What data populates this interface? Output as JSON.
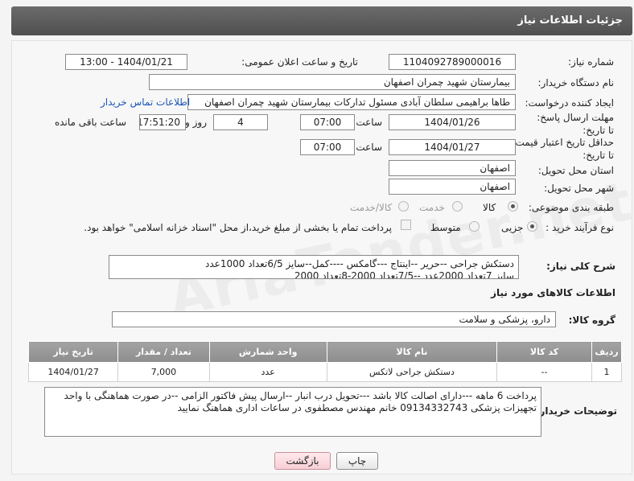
{
  "header": {
    "title": "جزئیات اطلاعات نیاز"
  },
  "fields": {
    "need_number_label": "شماره نیاز:",
    "need_number": "1104092789000016",
    "announce_label": "تاریخ و ساعت اعلان عمومی:",
    "announce_value": "1404/01/21 - 13:00",
    "buyer_org_label": "نام دستگاه خریدار:",
    "buyer_org": "بیمارستان شهید چمران اصفهان",
    "requester_label": "ایجاد کننده درخواست:",
    "requester": "طاها براهیمی سلطان آبادی مسئول تدارکات  بیمارستان شهید چمران اصفهان",
    "buyer_contact_link": "اطلاعات تماس خریدار",
    "reply_deadline_label": "مهلت ارسال پاسخ: تا تاریخ:",
    "reply_date": "1404/01/26",
    "time_label": "ساعت",
    "reply_time": "07:00",
    "days_value": "4",
    "days_label": "روز و",
    "remaining_time": "17:51:20",
    "remaining_label": "ساعت باقی مانده",
    "price_validity_label": "حداقل تاریخ اعتبار قیمت: تا تاریخ:",
    "price_date": "1404/01/27",
    "price_time": "07:00",
    "delivery_province_label": "استان محل تحویل:",
    "delivery_province": "اصفهان",
    "delivery_city_label": "شهر محل تحویل:",
    "delivery_city": "اصفهان",
    "category_label": "طبقه بندی موضوعی:",
    "category_options": [
      "کالا",
      "خدمت",
      "کالا/خدمت"
    ],
    "process_label": "نوع فرآیند خرید :",
    "process_options": [
      "جزیی",
      "متوسط"
    ],
    "treasury_note": "پرداخت تمام یا بخشی از مبلغ خرید،از محل \"اسناد خزانه اسلامی\" خواهد بود.",
    "general_desc_label": "شرح کلی نیاز:",
    "general_desc": "دستکش جراحی --حریر --اینتاج ---گامکس ----کمل--سایز 6/5تعداد 1000عدد\nسایز 7تعداد 2000عدد --7/5تعداد 2000-8تعداد 2000",
    "goods_info_title": "اطلاعات کالاهای مورد نیاز",
    "goods_group_label": "گروه کالا:",
    "goods_group": "دارو، پزشکی و سلامت",
    "buyer_notes_label": "توضیحات خریدار:",
    "buyer_notes": "پرداخت 6 ماهه ---دارای اصالت کالا باشد ---تحویل درب انبار --ارسال پیش فاکتور الزامی --در صورت هماهنگی با واحد تجهیزات پزشکی 09134332743 خانم مهندس مصطفوی در ساعات اداری هماهنگ نمایید"
  },
  "table": {
    "headers": [
      "ردیف",
      "کد کالا",
      "نام کالا",
      "واحد شمارش",
      "تعداد / مقدار",
      "تاریخ نیاز"
    ],
    "rows": [
      [
        "1",
        "--",
        "دستکش جراحی لاتکس",
        "عدد",
        "7,000",
        "1404/01/27"
      ]
    ]
  },
  "buttons": {
    "print": "چاپ",
    "back": "بازگشت"
  },
  "watermark": "AriaTender.net"
}
